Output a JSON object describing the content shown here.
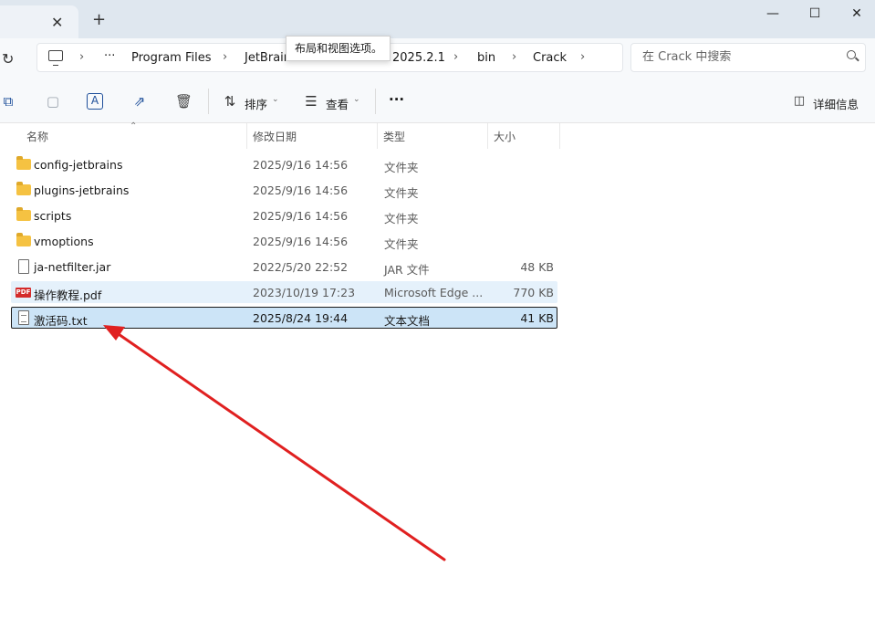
{
  "window": {
    "tab_close": "✕",
    "new_tab": "+",
    "minimize": "—",
    "maximize": "☐",
    "close": "✕"
  },
  "nav": {
    "refresh": "↻",
    "more": "···",
    "breadcrumbs": [
      "Program Files",
      "JetBrains",
      "2025.2.1",
      "bin",
      "Crack"
    ],
    "search_placeholder": "在 Crack 中搜索"
  },
  "tooltip": "布局和视图选项。",
  "toolbar": {
    "sort_label": "排序",
    "view_label": "查看",
    "more": "···",
    "details_label": "详细信息"
  },
  "columns": {
    "name": "名称",
    "modified": "修改日期",
    "type": "类型",
    "size": "大小"
  },
  "files": [
    {
      "name": "config-jetbrains",
      "modified": "2025/9/16 14:56",
      "type": "文件夹",
      "size": "",
      "icon": "folder-icon"
    },
    {
      "name": "plugins-jetbrains",
      "modified": "2025/9/16 14:56",
      "type": "文件夹",
      "size": "",
      "icon": "folder-icon"
    },
    {
      "name": "scripts",
      "modified": "2025/9/16 14:56",
      "type": "文件夹",
      "size": "",
      "icon": "folder-icon"
    },
    {
      "name": "vmoptions",
      "modified": "2025/9/16 14:56",
      "type": "文件夹",
      "size": "",
      "icon": "folder-icon"
    },
    {
      "name": "ja-netfilter.jar",
      "modified": "2022/5/20 22:52",
      "type": "JAR 文件",
      "size": "48 KB",
      "icon": "file-icon"
    },
    {
      "name": "操作教程.pdf",
      "modified": "2023/10/19 17:23",
      "type": "Microsoft Edge ...",
      "size": "770 KB",
      "icon": "pdf-icon",
      "pdf_badge": "PDF"
    },
    {
      "name": "激活码.txt",
      "modified": "2025/8/24 19:44",
      "type": "文本文档",
      "size": "41 KB",
      "icon": "txt-icon"
    }
  ],
  "colors": {
    "selected_bg": "#cce4f7",
    "hover_bg": "#e5f1fb",
    "annotation_arrow": "#e02020"
  }
}
